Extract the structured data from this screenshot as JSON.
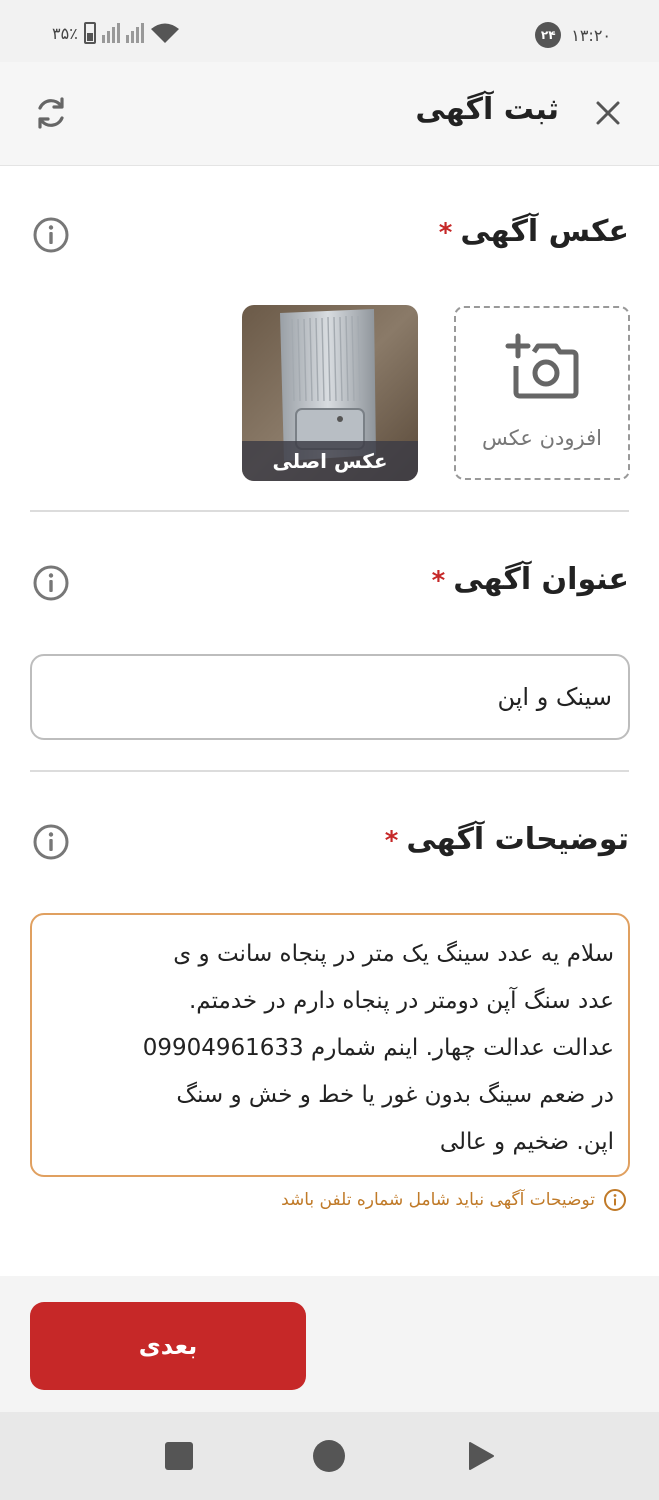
{
  "status_bar": {
    "time": "۱۳:۲۰",
    "notification_count": "۲۴",
    "battery": "۳۵٪"
  },
  "header": {
    "title": "ثبت آگهی",
    "icons": [
      "close-icon",
      "refresh-icon"
    ]
  },
  "photo_section": {
    "title": "عکس آگهی",
    "required_mark": "*",
    "add_photo_label": "افزودن عکس",
    "main_photo_label": "عکس اصلی"
  },
  "title_section": {
    "title": "عنوان آگهی",
    "required_mark": "*",
    "value": "سینک و اپن"
  },
  "description_section": {
    "title": "توضیحات آگهی",
    "required_mark": "*",
    "lines": [
      "سلام یه عدد سینگ یک متر در پنجاه سانت  و ی",
      "عدد سنگ آپن  دومتر در پنجاه  دارم در خدمتم.",
      "عدالت عدالت چهار. اینم شمارم 09904961633",
      "در ضعم سینگ بدون غور یا خط و خش   و سنگ",
      "اپن. ضخیم و عالی"
    ],
    "hint": "توضیحات آگهی نباید شامل شماره تلفن باشد"
  },
  "footer": {
    "next_label": "بعدی"
  },
  "colors": {
    "accent": "#c62828",
    "warning": "#c07a28",
    "warning_border": "#e0a060"
  }
}
